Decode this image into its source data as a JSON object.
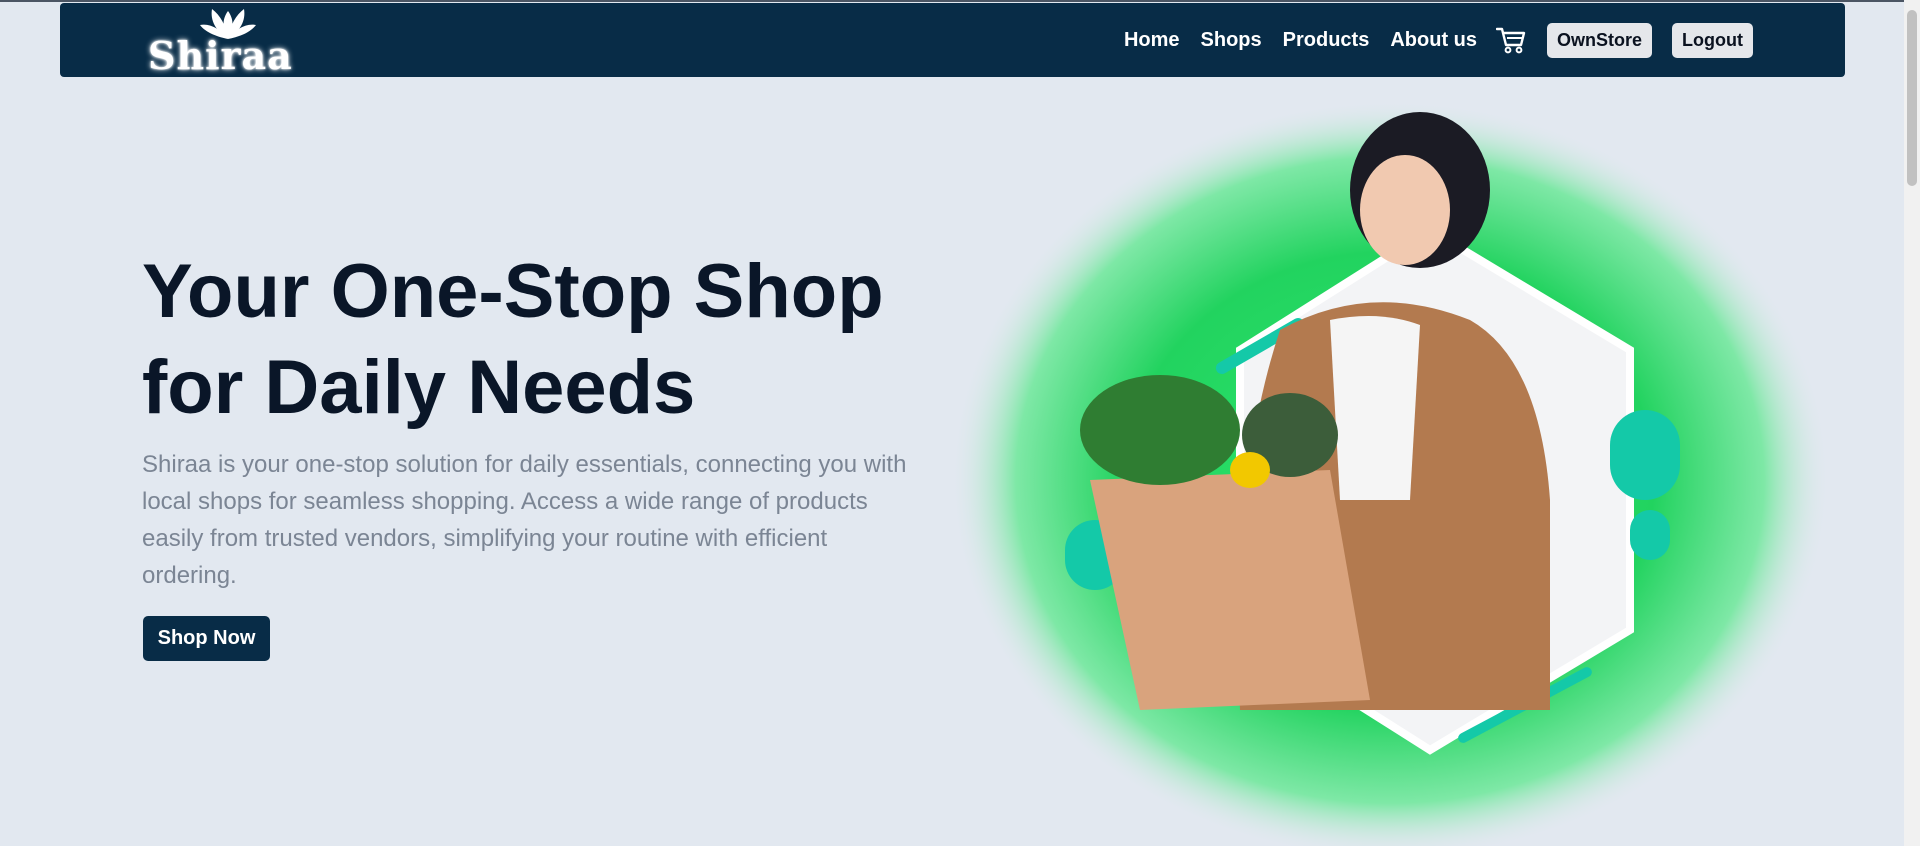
{
  "brand": {
    "name": "Shiraa"
  },
  "nav": {
    "links": [
      "Home",
      "Shops",
      "Products",
      "About us"
    ],
    "cart_icon": "cart-icon",
    "ownstore_label": "OwnStore",
    "logout_label": "Logout"
  },
  "hero": {
    "title_line1": "Your One-Stop Shop",
    "title_line2": "for Daily Needs",
    "description": "Shiraa is your one-stop solution for daily essentials, connecting you with local shops for seamless shopping. Access a wide range of products easily from trusted vendors, simplifying your routine with efficient ordering.",
    "cta_label": "Shop Now"
  },
  "colors": {
    "navbar_bg": "#082c47",
    "page_bg": "#e2e8f0",
    "accent_green": "#22d35f",
    "accent_teal": "#14c9a8",
    "title_color": "#0a1628",
    "desc_color": "#7b8594"
  }
}
